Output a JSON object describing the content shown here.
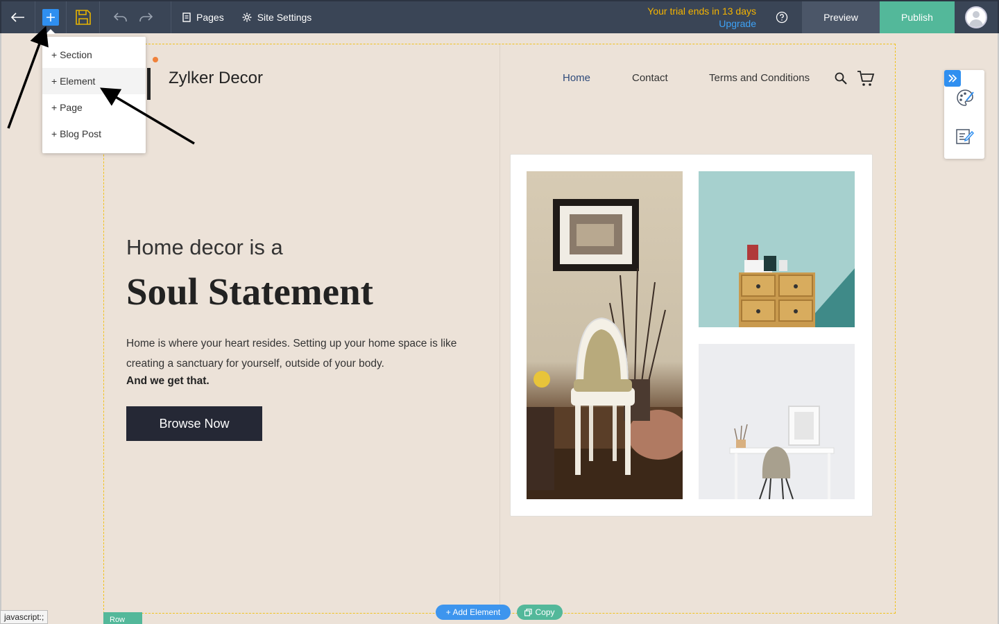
{
  "toolbar": {
    "pages_label": "Pages",
    "site_settings_label": "Site Settings",
    "trial_text": "Your trial ends in 13 days",
    "upgrade_label": "Upgrade",
    "preview_label": "Preview",
    "publish_label": "Publish"
  },
  "add_menu": {
    "items": [
      "+ Section",
      "+ Element",
      "+ Page",
      "+ Blog Post"
    ]
  },
  "site": {
    "brand": "Zylker Decor",
    "nav": [
      "Home",
      "Contact",
      "Terms and Conditions"
    ],
    "hero_small": "Home decor is a",
    "hero_big": "Soul Statement",
    "hero_paragraph": "Home is where your heart resides. Setting up your home space is like creating a sanctuary for yourself, outside of your body.",
    "hero_strong": "And we get that.",
    "cta_label": "Browse Now"
  },
  "editor": {
    "add_element_label": "+ Add Element",
    "copy_label": "Copy",
    "row_label": "Row",
    "status_text": "javascript:;"
  },
  "colors": {
    "toolbar_bg": "#3a4556",
    "accent_blue": "#2f8ff0",
    "publish_green": "#53b89a",
    "trial_yellow": "#f5b400",
    "page_bg": "#ece2d8",
    "cta_bg": "#252835"
  }
}
